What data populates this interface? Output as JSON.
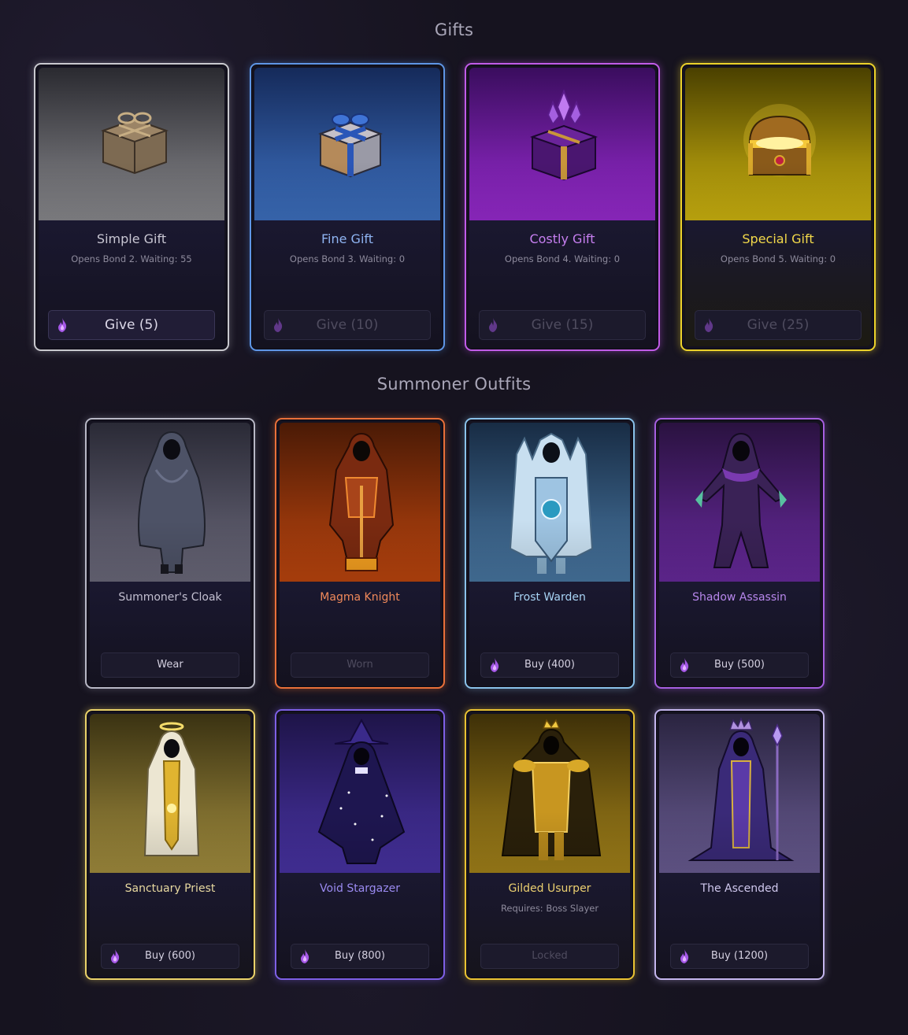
{
  "sections": {
    "gifts_title": "Gifts",
    "outfits_title": "Summoner Outfits"
  },
  "gifts": [
    {
      "name": "Simple Gift",
      "detail": "Opens Bond 2. Waiting: 55",
      "button": "Give (5)",
      "enabled": true,
      "icon": "wrapped-parcel-icon",
      "border": "#c9c9cf",
      "name_color": "#c8c6d2"
    },
    {
      "name": "Fine Gift",
      "detail": "Opens Bond 3. Waiting: 0",
      "button": "Give (10)",
      "enabled": false,
      "icon": "blue-ribbon-gift-icon",
      "border": "#5f96e6",
      "name_color": "#8fb4f2"
    },
    {
      "name": "Costly Gift",
      "detail": "Opens Bond 4. Waiting: 0",
      "button": "Give (15)",
      "enabled": false,
      "icon": "crystal-gift-box-icon",
      "border": "#c15ce8",
      "name_color": "#c77ff0"
    },
    {
      "name": "Special Gift",
      "detail": "Opens Bond 5. Waiting: 0",
      "button": "Give (25)",
      "enabled": false,
      "icon": "treasure-chest-icon",
      "border": "#ecd22b",
      "name_color": "#f3d94a"
    }
  ],
  "outfits": [
    {
      "name": "Summoner's Cloak",
      "detail": "",
      "button": "Wear",
      "enabled": true,
      "show_cost_icon": false,
      "icon": "hooded-cloak-figure-icon",
      "border": "#b8b8c6",
      "name_color": "#c2bfd0"
    },
    {
      "name": "Magma Knight",
      "detail": "",
      "button": "Worn",
      "enabled": false,
      "show_cost_icon": false,
      "icon": "magma-armored-knight-icon",
      "border": "#e9703a",
      "name_color": "#f0895a"
    },
    {
      "name": "Frost Warden",
      "detail": "",
      "button": "Buy (400)",
      "enabled": true,
      "show_cost_icon": true,
      "icon": "frost-armored-warden-icon",
      "border": "#8ac2ea",
      "name_color": "#a8d4f5"
    },
    {
      "name": "Shadow Assassin",
      "detail": "",
      "button": "Buy (500)",
      "enabled": true,
      "show_cost_icon": true,
      "icon": "shadow-assassin-figure-icon",
      "border": "#a65fe0",
      "name_color": "#b787ec"
    },
    {
      "name": "Sanctuary Priest",
      "detail": "",
      "button": "Buy (600)",
      "enabled": true,
      "show_cost_icon": true,
      "icon": "haloed-priest-figure-icon",
      "border": "#ead26a",
      "name_color": "#e8d9a0"
    },
    {
      "name": "Void Stargazer",
      "detail": "",
      "button": "Buy (800)",
      "enabled": true,
      "show_cost_icon": true,
      "icon": "starry-wizard-figure-icon",
      "border": "#7e60e6",
      "name_color": "#9a8af0"
    },
    {
      "name": "Gilded Usurper",
      "detail": "Requires: Boss Slayer",
      "button": "Locked",
      "enabled": false,
      "show_cost_icon": false,
      "icon": "crowned-golden-usurper-icon",
      "border": "#e9c233",
      "name_color": "#ecd070"
    },
    {
      "name": "The Ascended",
      "detail": "",
      "button": "Buy (1200)",
      "enabled": true,
      "show_cost_icon": true,
      "icon": "ascended-robed-mage-icon",
      "border": "#c4b6ee",
      "name_color": "#d0c8ee"
    }
  ]
}
